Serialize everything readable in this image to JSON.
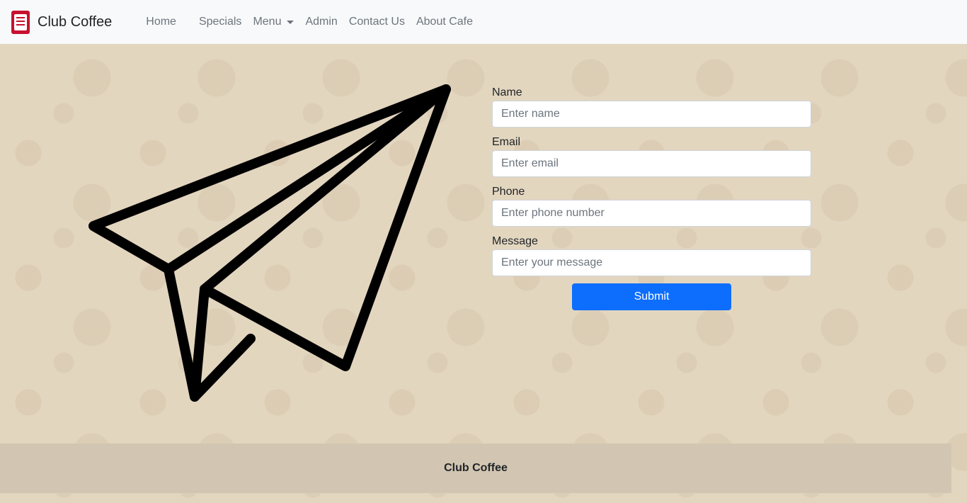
{
  "navbar": {
    "brand": "Club Coffee",
    "links": {
      "home": "Home",
      "specials": "Specials",
      "menu": "Menu",
      "admin": "Admin",
      "contact": "Contact Us",
      "about": "About Cafe"
    }
  },
  "form": {
    "name": {
      "label": "Name",
      "placeholder": "Enter name"
    },
    "email": {
      "label": "Email",
      "placeholder": "Enter email"
    },
    "phone": {
      "label": "Phone",
      "placeholder": "Enter phone number"
    },
    "message": {
      "label": "Message",
      "placeholder": "Enter your message"
    },
    "submit_label": "Submit"
  },
  "footer": {
    "text": "Club Coffee"
  },
  "colors": {
    "primary_button": "#0d6efd",
    "navbar_bg": "#f8f9fa",
    "page_bg": "#e3d6bf",
    "footer_bg": "#d2c6b2",
    "logo_red": "#c8102e"
  },
  "icons": {
    "hero": "paper-plane-icon",
    "logo": "cafe-logo-icon",
    "menu_dropdown": "caret-down-icon"
  }
}
